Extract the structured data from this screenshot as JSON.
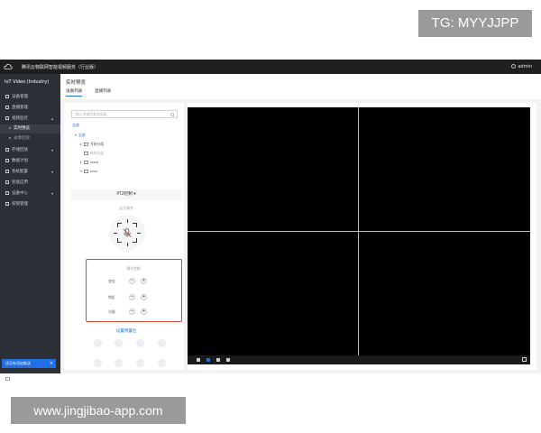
{
  "overlay": {
    "tg_label": "TG: MYYJJPP",
    "url_label": "www.jingjibao-app.com"
  },
  "topbar": {
    "app_title": "腾讯云物联网智能视频服务（行业版）",
    "user": "admin"
  },
  "sidebar": {
    "title": "IoT Video (Industry)",
    "items": [
      {
        "label": "设备管理",
        "icon": "device-icon"
      },
      {
        "label": "直播管理",
        "icon": "live-icon"
      },
      {
        "label": "视频监控",
        "icon": "monitor-icon",
        "expanded": true
      },
      {
        "label": "实时预览",
        "sub": true,
        "active": true
      },
      {
        "label": "录像回放",
        "sub": true
      },
      {
        "label": "存储回放",
        "icon": "storage-icon"
      },
      {
        "label": "数据计划",
        "icon": "plan-icon"
      },
      {
        "label": "系统配置",
        "icon": "settings-icon"
      },
      {
        "label": "智能应用",
        "icon": "ai-icon"
      },
      {
        "label": "设备中心",
        "icon": "center-icon"
      },
      {
        "label": "权限管理",
        "icon": "user-icon"
      }
    ],
    "toast": "还没有添加推送"
  },
  "main": {
    "title": "实时预览",
    "tabs": [
      {
        "label": "设备列表",
        "active": true
      },
      {
        "label": "直播列表",
        "active": false
      }
    ],
    "search_placeholder": "输入关键字查询设备",
    "tree_link": "全部",
    "tree": [
      {
        "label": "全部",
        "level": 0
      },
      {
        "label": "开始分组",
        "level": 1
      },
      {
        "label": "新的分组",
        "level": 1,
        "muted": true
      },
      {
        "label": "www",
        "level": 1
      },
      {
        "label": "aiao",
        "level": 1
      }
    ],
    "ptz": {
      "title": "PTZ控制",
      "subtitle": "云台调节",
      "lens_title": "镜头控制",
      "lens_rows": [
        "变倍",
        "焦距",
        "光圈"
      ],
      "minus": "−",
      "plus": "+",
      "preset_link": "设置预置位"
    }
  }
}
